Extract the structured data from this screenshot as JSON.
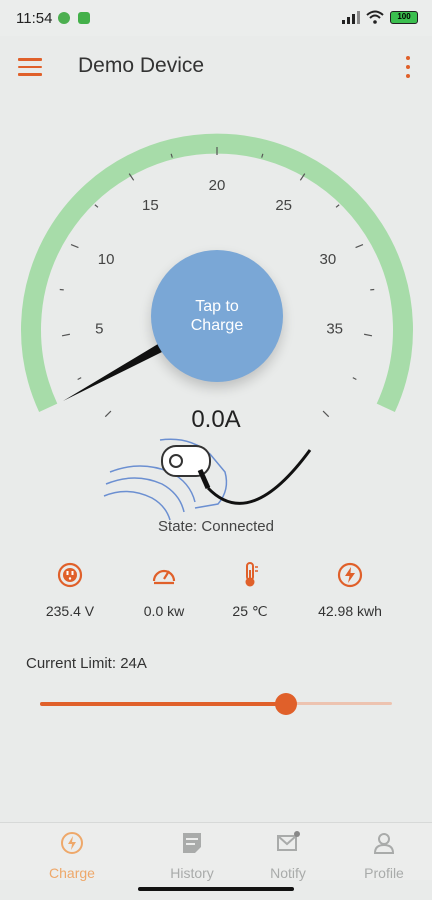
{
  "status_bar": {
    "time": "11:54",
    "battery": "100"
  },
  "app_bar": {
    "title": "Demo Device"
  },
  "gauge": {
    "ticks": [
      {
        "label": "5"
      },
      {
        "label": "10"
      },
      {
        "label": "15"
      },
      {
        "label": "20"
      },
      {
        "label": "25"
      },
      {
        "label": "30"
      },
      {
        "label": "35"
      }
    ],
    "needle_value": 0,
    "arc_color": "#a7dca9",
    "button_line1": "Tap to",
    "button_line2": "Charge",
    "button_color": "#7aa7d6"
  },
  "current_reading": "0.0A",
  "state_text": "State: Connected",
  "stats": [
    {
      "icon": "outlet-icon",
      "value": "235.4 V"
    },
    {
      "icon": "speedometer-icon",
      "value": "0.0 kw"
    },
    {
      "icon": "thermometer-icon",
      "value": "25 ℃"
    },
    {
      "icon": "lightning-icon",
      "value": "42.98 kwh"
    }
  ],
  "current_limit": {
    "label": "Current Limit: 24A",
    "fraction": 0.7
  },
  "bottom_nav": [
    {
      "label": "Charge",
      "icon": "charge-icon",
      "active": true
    },
    {
      "label": "History",
      "icon": "history-icon",
      "active": false
    },
    {
      "label": "Notify",
      "icon": "mail-icon",
      "active": false
    },
    {
      "label": "Profile",
      "icon": "person-icon",
      "active": false
    }
  ],
  "accent_color": "#e0602a"
}
